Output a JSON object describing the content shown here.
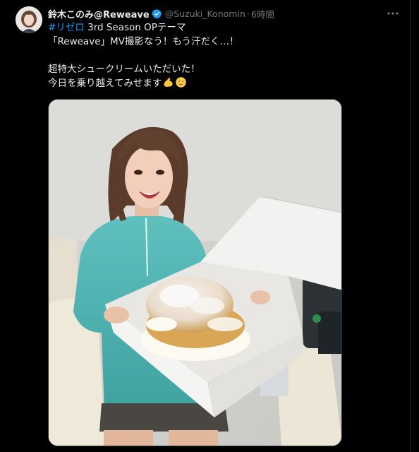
{
  "tweet": {
    "display_name": "鈴木このみ@Reweave",
    "handle": "@Suzuki_Konomin",
    "separator": "·",
    "time": "6時間",
    "hashtag": "#リゼロ",
    "line1_rest": " 3rd Season OPテーマ",
    "line2": "「Reweave」MV撮影なう！もう汗だく…！",
    "line3": "超特大シュークリームいただいた！",
    "line4": "今日を乗り越えてみせます",
    "emoji": [
      "flexed-biceps",
      "relieved-face"
    ]
  },
  "icons": {
    "verified": "verified-badge-icon",
    "more": "more-options-icon"
  },
  "colors": {
    "background": "#000000",
    "text": "#e7e9ea",
    "secondary": "#71767b",
    "accent": "#1d9bf0"
  }
}
